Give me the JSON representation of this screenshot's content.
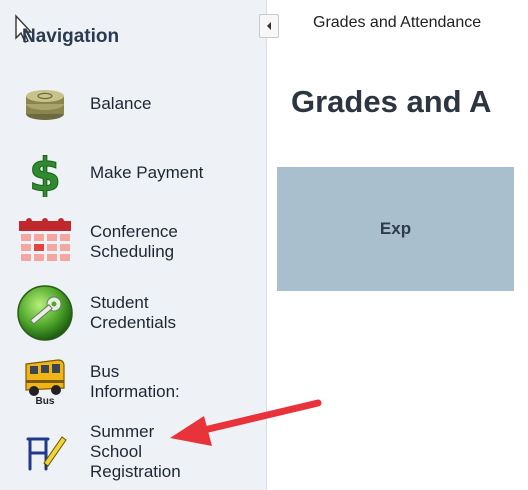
{
  "sidebar": {
    "title": "Navigation",
    "items": [
      {
        "label": "Balance",
        "icon": "coins-icon"
      },
      {
        "label": "Make Payment",
        "icon": "dollar-icon"
      },
      {
        "label": "Conference\nScheduling",
        "icon": "calendar-icon"
      },
      {
        "label": "Student\nCredentials",
        "icon": "key-icon"
      },
      {
        "label": "Bus\nInformation:",
        "icon": "bus-icon",
        "icon_caption": "Bus"
      },
      {
        "label": "Summer\nSchool\nRegistration",
        "icon": "desk-icon"
      }
    ]
  },
  "header": {
    "breadcrumb": "Grades and Attendance"
  },
  "main": {
    "title": "Grades and A",
    "panel_label": "Exp"
  },
  "colors": {
    "sidebar_bg": "#eef2f6",
    "panel_bg": "#a9bfcd",
    "arrow": "#e8333a"
  }
}
